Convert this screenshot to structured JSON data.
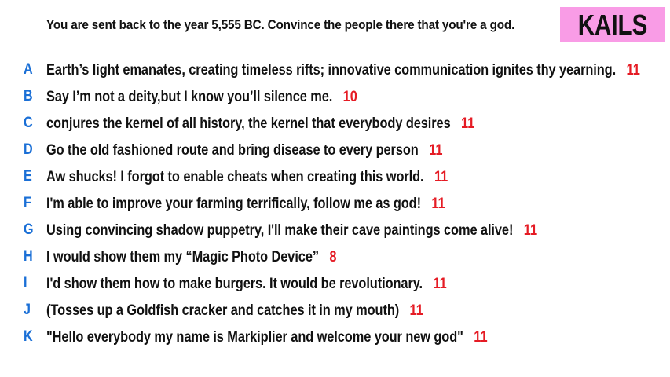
{
  "prompt": "You are sent back to the year 5,555 BC. Convince the people there that you're a god.",
  "player": {
    "name": "KAILS",
    "badge_color": "#f99ce6"
  },
  "colors": {
    "letter": "#1a6fd6",
    "score": "#e51b24",
    "text": "#111111"
  },
  "answers": [
    {
      "letter": "A",
      "text": "Earth’s light emanates, creating timeless rifts; innovative communication ignites thy yearning.",
      "score": "11"
    },
    {
      "letter": "B",
      "text": "Say I’m not a deity,but I know you’ll silence me.",
      "score": "10"
    },
    {
      "letter": "C",
      "text": "conjures the kernel of all history, the kernel that everybody desires",
      "score": "11"
    },
    {
      "letter": "D",
      "text": "Go the old fashioned route and bring disease to every person",
      "score": "11"
    },
    {
      "letter": "E",
      "text": "Aw shucks! I forgot to enable cheats when creating this world.",
      "score": "11"
    },
    {
      "letter": "F",
      "text": "I'm able to improve your farming terrifically, follow me as god!",
      "score": "11"
    },
    {
      "letter": "G",
      "text": "Using convincing shadow puppetry, I'll make their cave paintings come alive!",
      "score": "11"
    },
    {
      "letter": "H",
      "text": "I would show them my “Magic Photo Device”",
      "score": "8"
    },
    {
      "letter": "I",
      "text": "I'd show them how to make burgers. It would be revolutionary.",
      "score": "11"
    },
    {
      "letter": "J",
      "text": "(Tosses up a Goldfish cracker and catches it in my mouth)",
      "score": "11"
    },
    {
      "letter": "K",
      "text": "\"Hello everybody my name is Markiplier and welcome your new god\"",
      "score": "11"
    }
  ]
}
